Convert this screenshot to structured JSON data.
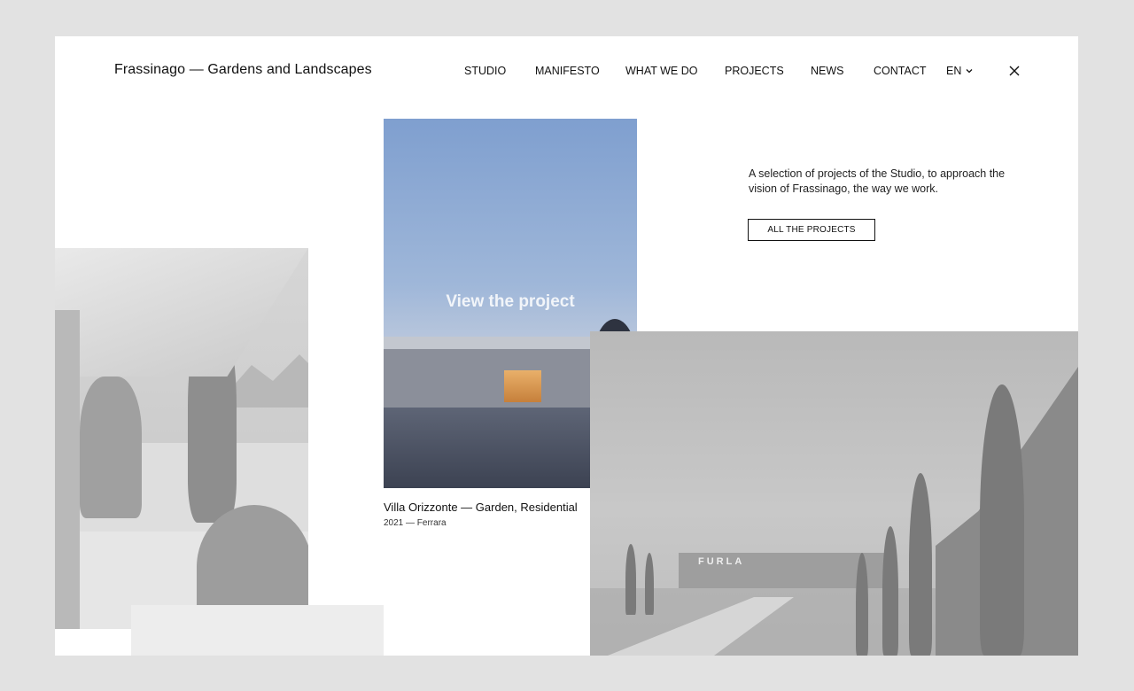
{
  "brand": "Frassinago — Gardens and Landscapes",
  "nav": {
    "items": [
      "STUDIO",
      "MANIFESTO",
      "WHAT WE DO",
      "PROJECTS",
      "NEWS",
      "CONTACT"
    ],
    "language": "EN",
    "icons": [
      "chevron-down-icon",
      "close-icon"
    ]
  },
  "featured": {
    "overlay": "View the project",
    "title": "Villa Orizzonte — Garden, Residential",
    "meta": "2021 — Ferrara"
  },
  "intro": {
    "text": "A selection of projects of the Studio, to approach the vision of Frassinago, the way we work.",
    "button": "ALL THE PROJECTS"
  },
  "right_image": {
    "sign": "FURLA"
  },
  "colors": {
    "background": "#e2e2e2",
    "page": "#ffffff",
    "text": "#111111"
  }
}
